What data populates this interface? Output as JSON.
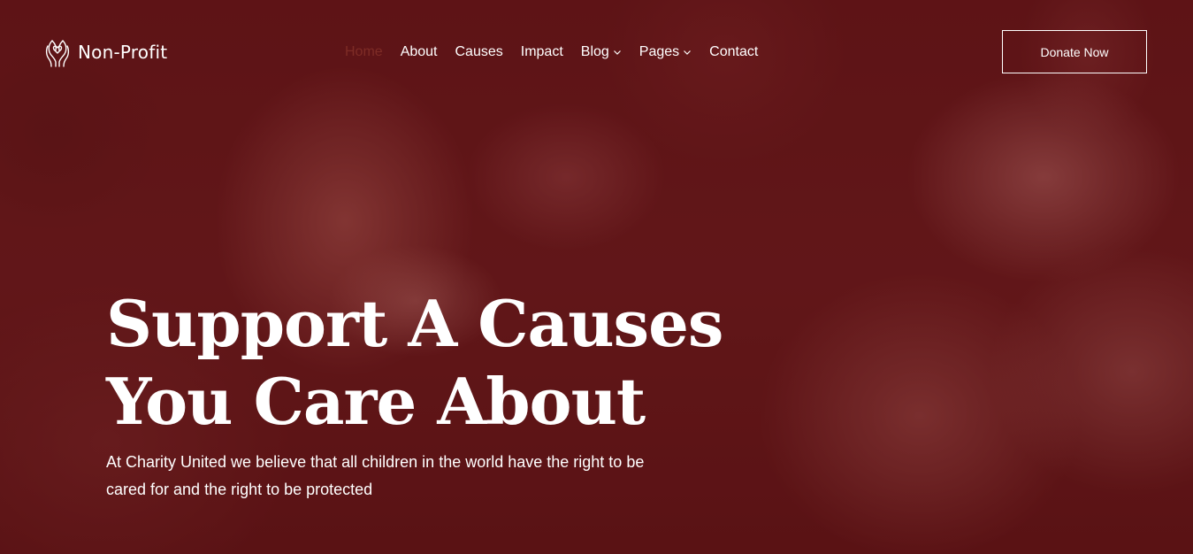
{
  "header": {
    "logo_text": "Non-Profit",
    "logo_icon": "hands-heart-icon",
    "nav": [
      {
        "label": "Home",
        "active": true
      },
      {
        "label": "About"
      },
      {
        "label": "Causes"
      },
      {
        "label": "Impact"
      },
      {
        "label": "Blog",
        "dropdown": true
      },
      {
        "label": "Pages",
        "dropdown": true
      },
      {
        "label": "Contact"
      }
    ],
    "cta_label": "Donate Now"
  },
  "hero": {
    "headline_line1": "Support A Causes",
    "headline_line2": "You Care About",
    "subtext_line1": "At Charity United we believe that all children in the world have the right to be",
    "subtext_line2": "cared for and the right to be protected"
  },
  "colors": {
    "overlay": "#5a1416",
    "active_nav": "#7e2c26",
    "text": "#ffffff"
  }
}
